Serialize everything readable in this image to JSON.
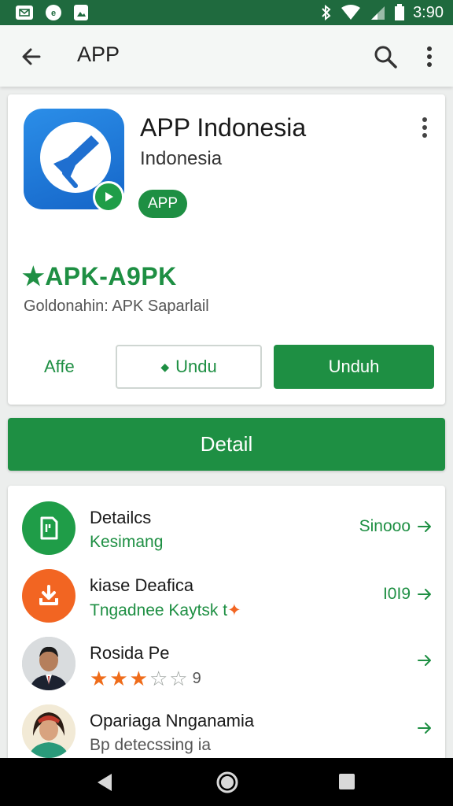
{
  "status_bar": {
    "time": "3:90",
    "background": "#1f6a3e",
    "icons_left": [
      "mail-icon",
      "circle-e-icon",
      "image-icon"
    ],
    "icons_right": [
      "bluetooth-icon",
      "wifi-icon",
      "signal-icon",
      "battery-icon"
    ]
  },
  "app_bar": {
    "title": "APP",
    "icons": [
      "back-arrow-icon",
      "search-icon",
      "more-vertical-icon"
    ]
  },
  "app_card": {
    "name": "APP Indonesia",
    "developer": "Indonesia",
    "chip_label": "APP",
    "apk_heading": "★APK-A9PK",
    "source_text": "Goldonahin: APK Saparlail",
    "link_label": "Affe",
    "outline_button_label": "Undu",
    "filled_button_label": "Unduh"
  },
  "detail_button_label": "Detail",
  "list_items": [
    {
      "title": "Detailcs",
      "subtitle": "Kesimang",
      "right_text": "Sinooo",
      "icon": "sd-card-icon",
      "icon_bg": "#1f9d48"
    },
    {
      "title": "kiase Deafica",
      "subtitle": "Tngadnee Kaytsk t",
      "subtitle_suffix": "✦",
      "right_text": "I0I9",
      "icon": "download-icon",
      "icon_bg": "#f26522"
    },
    {
      "title": "Rosida Pe",
      "rating": 3,
      "rating_max": 5,
      "rating_text": "9",
      "icon": "avatar-man"
    },
    {
      "title": "Opariaga Nnganamia",
      "subtitle": "Bp detecssing ia",
      "icon": "avatar-woman"
    }
  ],
  "colors": {
    "primary_green": "#1e8f43",
    "icon_blue": "#1f78d6",
    "accent_orange": "#f26522"
  },
  "nav_bar": {
    "icons": [
      "nav-back-icon",
      "nav-home-icon",
      "nav-recent-icon"
    ]
  }
}
